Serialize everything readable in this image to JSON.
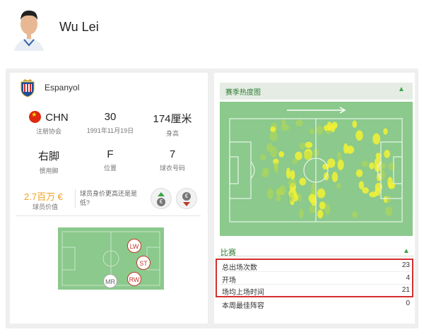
{
  "player": {
    "name": "Wu Lei"
  },
  "club": {
    "name": "Espanyol"
  },
  "stats": [
    {
      "value": "CHN",
      "label": "注册协会"
    },
    {
      "value": "30",
      "label": "1991年11月19日"
    },
    {
      "value": "174厘米",
      "label": "身高"
    },
    {
      "value": "右脚",
      "label": "惯用脚"
    },
    {
      "value": "F",
      "label": "位置"
    },
    {
      "value": "7",
      "label": "球衣号码"
    }
  ],
  "market_value": {
    "value": "2.7百万 €",
    "label": "球员价值",
    "question": "球员身价更高还是是低?",
    "coin_symbol": "€"
  },
  "positions": {
    "primary": [
      "LW",
      "ST",
      "RW"
    ],
    "secondary": [
      "MR"
    ]
  },
  "heatmap": {
    "title": "赛季热度图"
  },
  "matches": {
    "title": "比赛",
    "rows": [
      {
        "label": "总出场次数",
        "value": "23"
      },
      {
        "label": "开场",
        "value": "4"
      },
      {
        "label": "场均上场时间",
        "value": "21"
      },
      {
        "label": "本周最佳阵容",
        "value": "0"
      }
    ]
  },
  "colors": {
    "accent_green": "#3aa645",
    "market_value": "#f4a01f",
    "highlight_red": "#d32f2f",
    "pitch_green": "#8bc98c"
  }
}
